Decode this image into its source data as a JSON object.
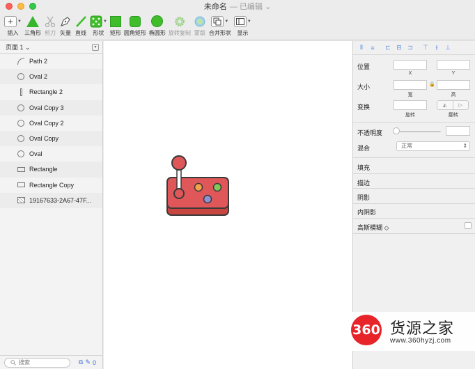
{
  "window": {
    "title": "未命名",
    "edited": "— 已编辑 ⌄"
  },
  "toolbar": {
    "insert": "插入",
    "triangle": "三角形",
    "scissors": "剪刀",
    "vector": "矢量",
    "line": "直线",
    "shape": "形状",
    "rect": "矩形",
    "rounded_rect": "圆角矩形",
    "oval": "椭圆形",
    "rotate_copy": "旋转复制",
    "mask": "蒙版",
    "combine": "合并形状",
    "view": "显示"
  },
  "layers": {
    "page_selector": "页面 1 ⌄",
    "items": [
      {
        "label": "Path 2",
        "icon": "path"
      },
      {
        "label": "Oval 2",
        "icon": "oval"
      },
      {
        "label": "Rectangle 2",
        "icon": "vrect"
      },
      {
        "label": "Oval Copy 3",
        "icon": "oval"
      },
      {
        "label": "Oval Copy 2",
        "icon": "oval"
      },
      {
        "label": "Oval Copy",
        "icon": "oval"
      },
      {
        "label": "Oval",
        "icon": "oval"
      },
      {
        "label": "Rectangle",
        "icon": "rect"
      },
      {
        "label": "Rectangle Copy",
        "icon": "rect"
      },
      {
        "label": "19167633-2A67-47F...",
        "icon": "image"
      }
    ],
    "search_placeholder": "搜索",
    "bottom_count": "0"
  },
  "inspector": {
    "position": "位置",
    "x": "X",
    "y": "Y",
    "size": "大小",
    "width": "宽",
    "height": "高",
    "transform": "变换",
    "rotate": "旋转",
    "flip": "翻转",
    "opacity": "不透明度",
    "blend": "混合",
    "blend_value": "正常",
    "fill": "填充",
    "border": "描边",
    "shadow": "阴影",
    "inner_shadow": "内阴影",
    "gaussian_blur": "高斯模糊 ◇"
  },
  "watermark": {
    "logo": "360",
    "name": "货源之家",
    "url": "www.360hyzj.com"
  },
  "colors": {
    "green_tool": "#3fbd2b",
    "joystick_body": "#e0575a",
    "joystick_base": "#c8463f",
    "btn_orange": "#f5a14a",
    "btn_green": "#7fc95b",
    "btn_blue": "#8a93d6",
    "outline": "#3a3a3a"
  }
}
